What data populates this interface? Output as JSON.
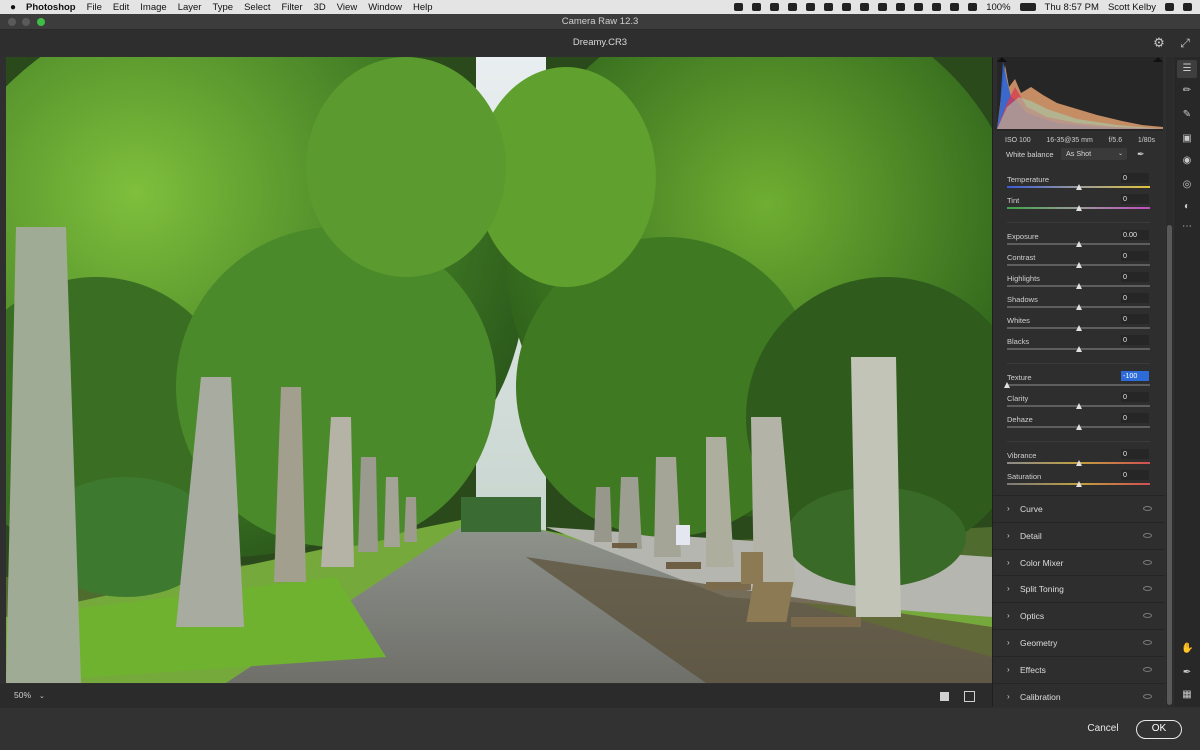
{
  "menubar": {
    "apple": "",
    "app": "Photoshop",
    "items": [
      "File",
      "Edit",
      "Image",
      "Layer",
      "Type",
      "Select",
      "Filter",
      "3D",
      "View",
      "Window",
      "Help"
    ],
    "battery": "100%",
    "time": "Thu 8:57 PM",
    "user": "Scott Kelby"
  },
  "window": {
    "title": "Camera Raw 12.3",
    "filename": "Dreamy.CR3"
  },
  "histogram": {
    "iso": "ISO 100",
    "lens": "16-35@35 mm",
    "aperture": "f/5.6",
    "shutter": "1/80s"
  },
  "basic": {
    "wb_label": "White balance",
    "wb_value": "As Shot",
    "sliders": [
      {
        "label": "Temperature",
        "value": "0",
        "pos": 0.5,
        "track": "temp"
      },
      {
        "label": "Tint",
        "value": "0",
        "pos": 0.5,
        "track": "tint"
      },
      {
        "label": "Exposure",
        "value": "0.00",
        "pos": 0.5,
        "track": "gray"
      },
      {
        "label": "Contrast",
        "value": "0",
        "pos": 0.5,
        "track": "gray"
      },
      {
        "label": "Highlights",
        "value": "0",
        "pos": 0.5,
        "track": "gray"
      },
      {
        "label": "Shadows",
        "value": "0",
        "pos": 0.5,
        "track": "gray"
      },
      {
        "label": "Whites",
        "value": "0",
        "pos": 0.5,
        "track": "gray"
      },
      {
        "label": "Blacks",
        "value": "0",
        "pos": 0.5,
        "track": "gray"
      },
      {
        "label": "Texture",
        "value": "-100",
        "pos": 0.0,
        "track": "gray",
        "active": true
      },
      {
        "label": "Clarity",
        "value": "0",
        "pos": 0.5,
        "track": "gray"
      },
      {
        "label": "Dehaze",
        "value": "0",
        "pos": 0.5,
        "track": "gray"
      },
      {
        "label": "Vibrance",
        "value": "0",
        "pos": 0.5,
        "track": "vib"
      },
      {
        "label": "Saturation",
        "value": "0",
        "pos": 0.5,
        "track": "sat"
      }
    ]
  },
  "sections": [
    "Curve",
    "Detail",
    "Color Mixer",
    "Split Toning",
    "Optics",
    "Geometry",
    "Effects",
    "Calibration"
  ],
  "status": {
    "zoom": "50%"
  },
  "actions": {
    "cancel": "Cancel",
    "ok": "OK"
  },
  "colors": {
    "accent": "#2d6bd9",
    "panel": "#2e2e2e",
    "background": "#2f2f2f"
  }
}
